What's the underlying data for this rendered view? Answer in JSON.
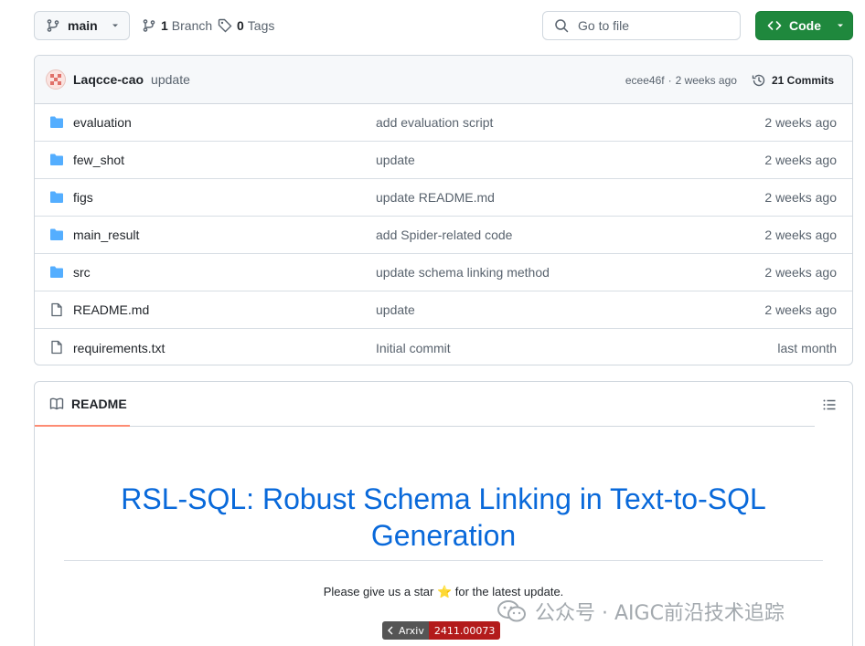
{
  "toolbar": {
    "branch": "main",
    "branches_count": "1",
    "branches_label": "Branch",
    "tags_count": "0",
    "tags_label": "Tags",
    "goto_placeholder": "Go to file",
    "code_label": "Code"
  },
  "commit": {
    "author": "Laqcce-cao",
    "message": "update",
    "hash": "ecee46f",
    "separator": "·",
    "age": "2 weeks ago",
    "commits_label": "21 Commits"
  },
  "files": [
    {
      "name": "evaluation",
      "type": "folder",
      "message": "add evaluation script",
      "age": "2 weeks ago"
    },
    {
      "name": "few_shot",
      "type": "folder",
      "message": "update",
      "age": "2 weeks ago"
    },
    {
      "name": "figs",
      "type": "folder",
      "message": "update README.md",
      "age": "2 weeks ago"
    },
    {
      "name": "main_result",
      "type": "folder",
      "message": "add Spider-related code",
      "age": "2 weeks ago"
    },
    {
      "name": "src",
      "type": "folder",
      "message": "update schema linking method",
      "age": "2 weeks ago"
    },
    {
      "name": "README.md",
      "type": "file",
      "message": "update",
      "age": "2 weeks ago"
    },
    {
      "name": "requirements.txt",
      "type": "file",
      "message": "Initial commit",
      "age": "last month"
    }
  ],
  "readme": {
    "tab_label": "README",
    "title": "RSL-SQL: Robust Schema Linking in Text-to-SQL Generation",
    "note": "Please give us a star ⭐ for the latest update.",
    "badge_left": "Arxiv",
    "badge_right": "2411.00073"
  },
  "watermark": "公众号 · AIGC前沿技术追踪",
  "colors": {
    "accent_green": "#1f883d",
    "link_blue": "#0969da",
    "folder_blue": "#54aeff",
    "tab_underline": "#fd8c73",
    "badge_red": "#b31b1b"
  }
}
